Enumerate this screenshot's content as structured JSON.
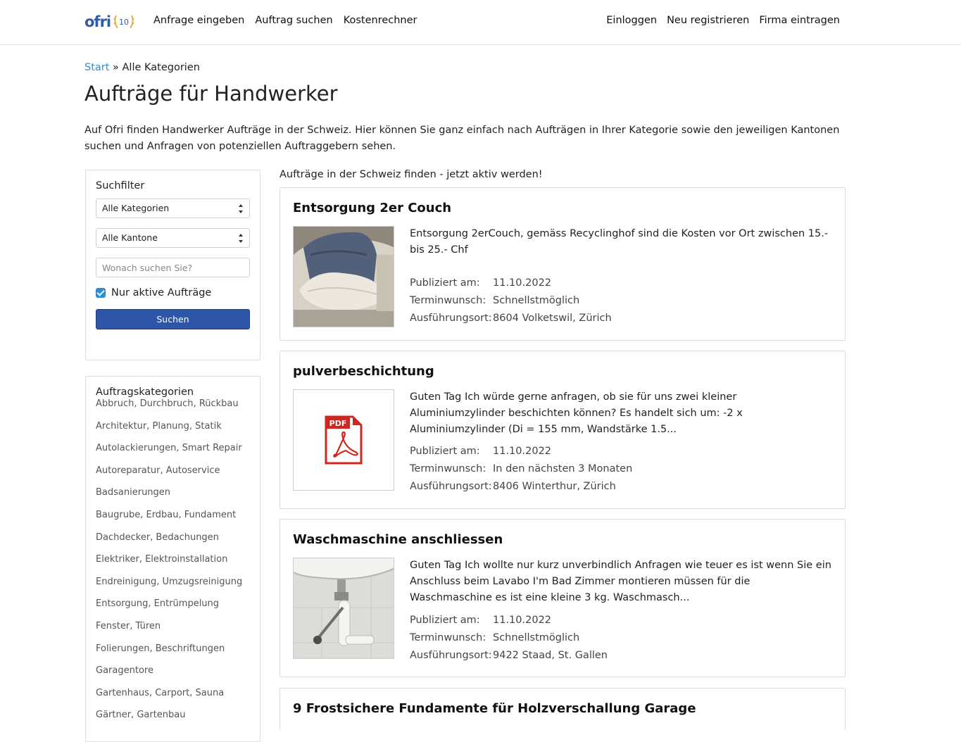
{
  "header": {
    "logo_text": "ofri",
    "logo_badge": "10",
    "nav_left": [
      "Anfrage eingeben",
      "Auftrag suchen",
      "Kostenrechner"
    ],
    "nav_right": [
      "Einloggen",
      "Neu registrieren",
      "Firma eintragen"
    ]
  },
  "breadcrumb": {
    "link": "Start",
    "separator": "»",
    "current": "Alle Kategorien"
  },
  "page_title": "Aufträge für Handwerker",
  "intro": "Auf Ofri finden Handwerker Aufträge in der Schweiz. Hier können Sie ganz einfach nach Aufträgen in Ihrer Kategorie sowie den jeweiligen Kantonen suchen und Anfragen von potenziellen Auftraggebern sehen.",
  "filter": {
    "title": "Suchfilter",
    "category_select": "Alle Kategorien",
    "canton_select": "Alle Kantone",
    "search_placeholder": "Wonach suchen Sie?",
    "active_only_label": "Nur aktive Aufträge",
    "active_only_checked": true,
    "button_label": "Suchen"
  },
  "categories": {
    "title": "Auftragskategorien",
    "items": [
      "Abbruch, Durchbruch, Rückbau",
      "Architektur, Planung, Statik",
      "Autolackierungen, Smart Repair",
      "Autoreparatur, Autoservice",
      "Badsanierungen",
      "Baugrube, Erdbau, Fundament",
      "Dachdecker, Bedachungen",
      "Elektriker, Elektroinstallation",
      "Endreinigung, Umzugsreinigung",
      "Entsorgung, Entrümpelung",
      "Fenster, Türen",
      "Folierungen, Beschriftungen",
      "Garagentore",
      "Gartenhaus, Carport, Sauna",
      "Gärtner, Gartenbau"
    ]
  },
  "list_intro": "Aufträge in der Schweiz finden - jetzt aktiv werden!",
  "meta_labels": {
    "published": "Publiziert am:",
    "date_wish": "Terminwunsch:",
    "location": "Ausführungsort:"
  },
  "jobs": [
    {
      "title": "Entsorgung 2er Couch",
      "description": "Entsorgung 2erCouch, gemäss Recyclinghof sind die Kosten vor Ort zwischen 15.- bis 25.- Chf",
      "published": "11.10.2022",
      "date_wish": "Schnellstmöglich",
      "location": "8604 Volketswil, Zürich",
      "thumb": "couch-photo"
    },
    {
      "title": "pulverbeschichtung",
      "description": "Guten Tag Ich würde gerne anfragen, ob sie für uns zwei kleiner Aluminiumzylinder beschichten können? Es handelt sich um: -2 x Aluminiumzylinder (Di = 155 mm, Wandstärke 1.5...",
      "published": "11.10.2022",
      "date_wish": "In den nächsten 3 Monaten",
      "location": "8406 Winterthur, Zürich",
      "thumb": "pdf-icon",
      "thumb_label": "PDF"
    },
    {
      "title": "Waschmaschine anschliessen",
      "description": "Guten Tag Ich wollte nur kurz unverbindlich Anfragen wie teuer es ist wenn Sie ein Anschluss beim Lavabo I'm Bad Zimmer montieren müssen für die Waschmaschine es ist eine kleine 3 kg. Waschmasch...",
      "published": "11.10.2022",
      "date_wish": "Schnellstmöglich",
      "location": "9422 Staad, St. Gallen",
      "thumb": "sink-photo"
    },
    {
      "title": "9 Frostsichere Fundamente für Holzverschallung Garage"
    }
  ],
  "colors": {
    "brand_blue": "#2f5ca8",
    "link_blue": "#2a8fd2",
    "button_blue": "#2f55a6",
    "pdf_red": "#d0261f"
  }
}
